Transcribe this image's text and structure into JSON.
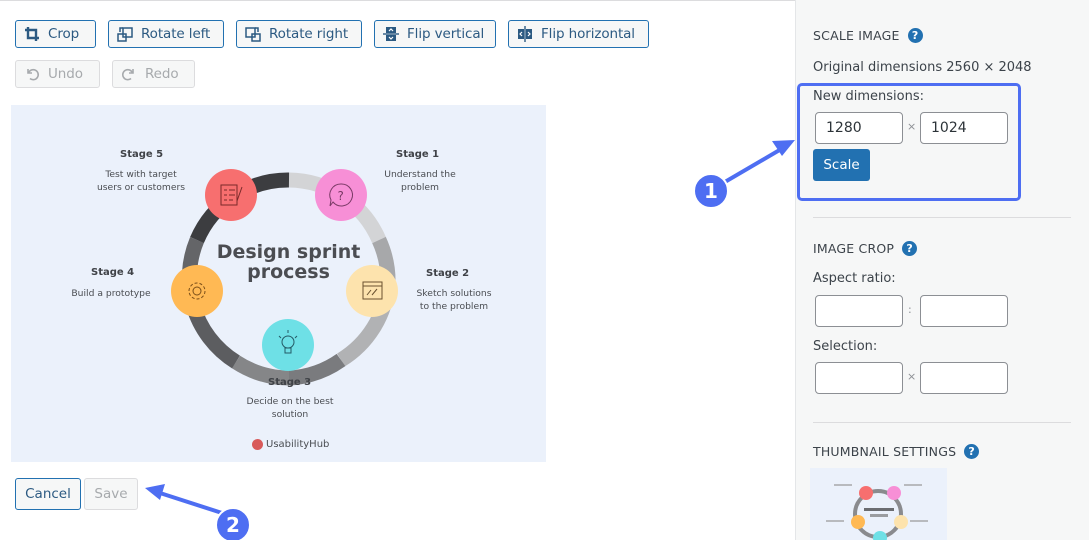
{
  "toolbar": {
    "buttons": [
      {
        "label": "Crop",
        "icon": "crop-icon"
      },
      {
        "label": "Rotate left",
        "icon": "rotate-left-icon"
      },
      {
        "label": "Rotate right",
        "icon": "rotate-right-icon"
      },
      {
        "label": "Flip vertical",
        "icon": "flip-vertical-icon"
      },
      {
        "label": "Flip horizontal",
        "icon": "flip-horizontal-icon"
      }
    ],
    "undo_label": "Undo",
    "redo_label": "Redo"
  },
  "image": {
    "title_line1": "Design sprint",
    "title_line2": "process",
    "brand": "UsabilityHub",
    "stages": [
      {
        "title": "Stage 1",
        "desc1": "Understand the",
        "desc2": "problem",
        "color": "#f78fd6",
        "icon": "question-bubble-icon"
      },
      {
        "title": "Stage 2",
        "desc1": "Sketch solutions",
        "desc2": "to the problem",
        "color": "#fde3ad",
        "icon": "sketch-icon"
      },
      {
        "title": "Stage 3",
        "desc1": "Decide on the best",
        "desc2": "solution",
        "color": "#6ee0e6",
        "icon": "lightbulb-icon"
      },
      {
        "title": "Stage 4",
        "desc1": "Build a prototype",
        "desc2": "",
        "color": "#ffb954",
        "icon": "gear-icon"
      },
      {
        "title": "Stage 5",
        "desc1": "Test with target",
        "desc2": "users or customers",
        "color": "#f76f6f",
        "icon": "checklist-icon"
      }
    ]
  },
  "actions": {
    "cancel_label": "Cancel",
    "save_label": "Save"
  },
  "sidebar": {
    "scale": {
      "heading": "SCALE IMAGE",
      "original": "Original dimensions 2560 × 2048",
      "new_label": "New dimensions:",
      "width_value": "1280",
      "height_value": "1024",
      "separator": "×",
      "button": "Scale"
    },
    "crop": {
      "heading": "IMAGE CROP",
      "aspect_label": "Aspect ratio:",
      "aspect_sep": ":",
      "selection_label": "Selection:",
      "selection_sep": "×",
      "aspect_w": "",
      "aspect_h": "",
      "sel_w": "",
      "sel_h": ""
    },
    "thumbnail": {
      "heading": "THUMBNAIL SETTINGS"
    },
    "help_glyph": "?"
  },
  "annotations": {
    "badge1": "1",
    "badge2": "2",
    "color": "#4e6ef2"
  }
}
